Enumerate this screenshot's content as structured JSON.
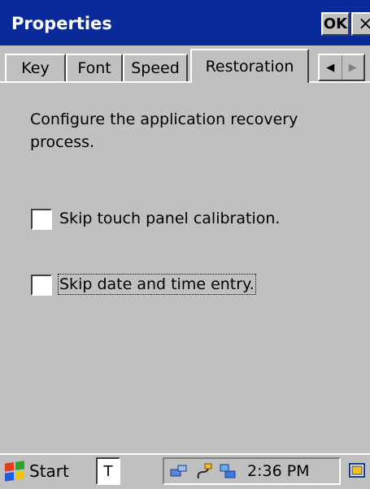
{
  "window": {
    "title": "Properties",
    "ok_label": "OK",
    "close_label": "×"
  },
  "tabs": [
    {
      "label": "Key"
    },
    {
      "label": "Font"
    },
    {
      "label": "Speed"
    },
    {
      "label": "Restoration",
      "selected": true
    }
  ],
  "tab_scroll": {
    "left": "◀",
    "right": "▶"
  },
  "content": {
    "description": "Configure the application recovery process.",
    "checkboxes": [
      {
        "label": "Skip touch panel calibration.",
        "checked": false
      },
      {
        "label": "Skip date and time entry.",
        "checked": false,
        "focused": true
      }
    ]
  },
  "taskbar": {
    "start_label": "Start",
    "input_indicator": "T",
    "clock": "2:36 PM",
    "tray_icons": [
      "network-icon",
      "power-plug-icon",
      "connection-icon"
    ],
    "desktop_icon": "desktop-icon"
  },
  "colors": {
    "titlebar": "#0a2a9a",
    "face": "#c0c0c0"
  }
}
